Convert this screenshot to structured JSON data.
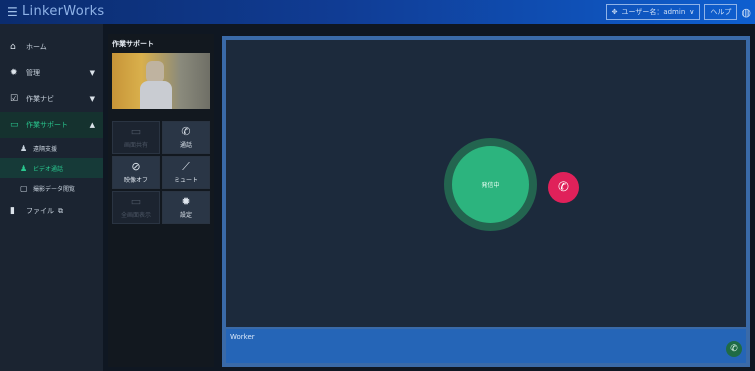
{
  "header": {
    "logo_text": "LinkerWorks",
    "user_label": "ユーザー名：admin",
    "help_label": "ヘルプ"
  },
  "sidebar": {
    "items": [
      {
        "label": "ホーム",
        "icon": "home-icon"
      },
      {
        "label": "管理",
        "icon": "gear-icon"
      },
      {
        "label": "作業ナビ",
        "icon": "checklist-icon"
      },
      {
        "label": "作業サポート",
        "icon": "monitor-icon"
      },
      {
        "label": "ファイル",
        "icon": "file-icon"
      }
    ],
    "subitems": [
      {
        "label": "遠隔支援",
        "icon": "person-icon"
      },
      {
        "label": "ビデオ通話",
        "icon": "person-icon"
      },
      {
        "label": "撮影データ閲覧",
        "icon": "image-icon"
      }
    ],
    "accent_color": "#29c78e"
  },
  "support_panel": {
    "title": "作業サポート",
    "buttons": [
      {
        "label": "画面共有",
        "icon": "monitor-icon",
        "state": "disabled"
      },
      {
        "label": "通話",
        "icon": "phone-icon",
        "state": "active"
      },
      {
        "label": "映像オフ",
        "icon": "camera-off-icon",
        "state": "active"
      },
      {
        "label": "ミュート",
        "icon": "mic-off-icon",
        "state": "active"
      },
      {
        "label": "全画面表示",
        "icon": "fullscreen-icon",
        "state": "disabled"
      },
      {
        "label": "設定",
        "icon": "gear-icon",
        "state": "active"
      }
    ]
  },
  "call": {
    "status_label": "発信中",
    "worker_name": "Worker",
    "call_color": "#2cb47e",
    "hangup_color": "#e0215a"
  }
}
